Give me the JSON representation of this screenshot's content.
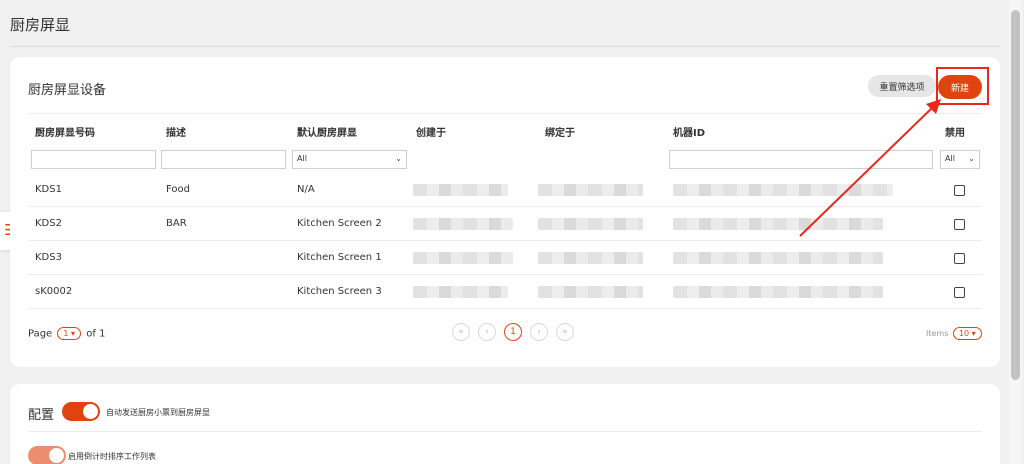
{
  "page": {
    "title": "厨房屏显"
  },
  "devices_card": {
    "title": "厨房屏显设备",
    "reset_label": "重置筛选项",
    "new_label": "新建",
    "columns": [
      "厨房屏显号码",
      "描述",
      "默认厨房屏显",
      "创建于",
      "绑定于",
      "机器ID",
      "禁用"
    ],
    "filters": {
      "default_screen": "All",
      "disabled": "All"
    },
    "rows": [
      {
        "code": "KDS1",
        "desc": "Food",
        "default": "N/A"
      },
      {
        "code": "KDS2",
        "desc": "BAR",
        "default": "Kitchen Screen 2"
      },
      {
        "code": "KDS3",
        "desc": "",
        "default": "Kitchen Screen 1"
      },
      {
        "code": "sK0002",
        "desc": "",
        "default": "Kitchen Screen 3"
      }
    ],
    "pagination": {
      "page_label": "Page",
      "page": "1",
      "of_label": "of 1",
      "current": "1",
      "items_label": "Items",
      "per_page": "10"
    }
  },
  "config_card": {
    "title": "配置",
    "toggle1_label": "自动发送厨房小票到厨房屏显",
    "toggle2_label": "启用倒计时排序工作列表"
  },
  "colors": {
    "accent": "#e0440e",
    "annotation": "#e8281c"
  },
  "icons": {
    "side_tab": "menu-icon"
  }
}
